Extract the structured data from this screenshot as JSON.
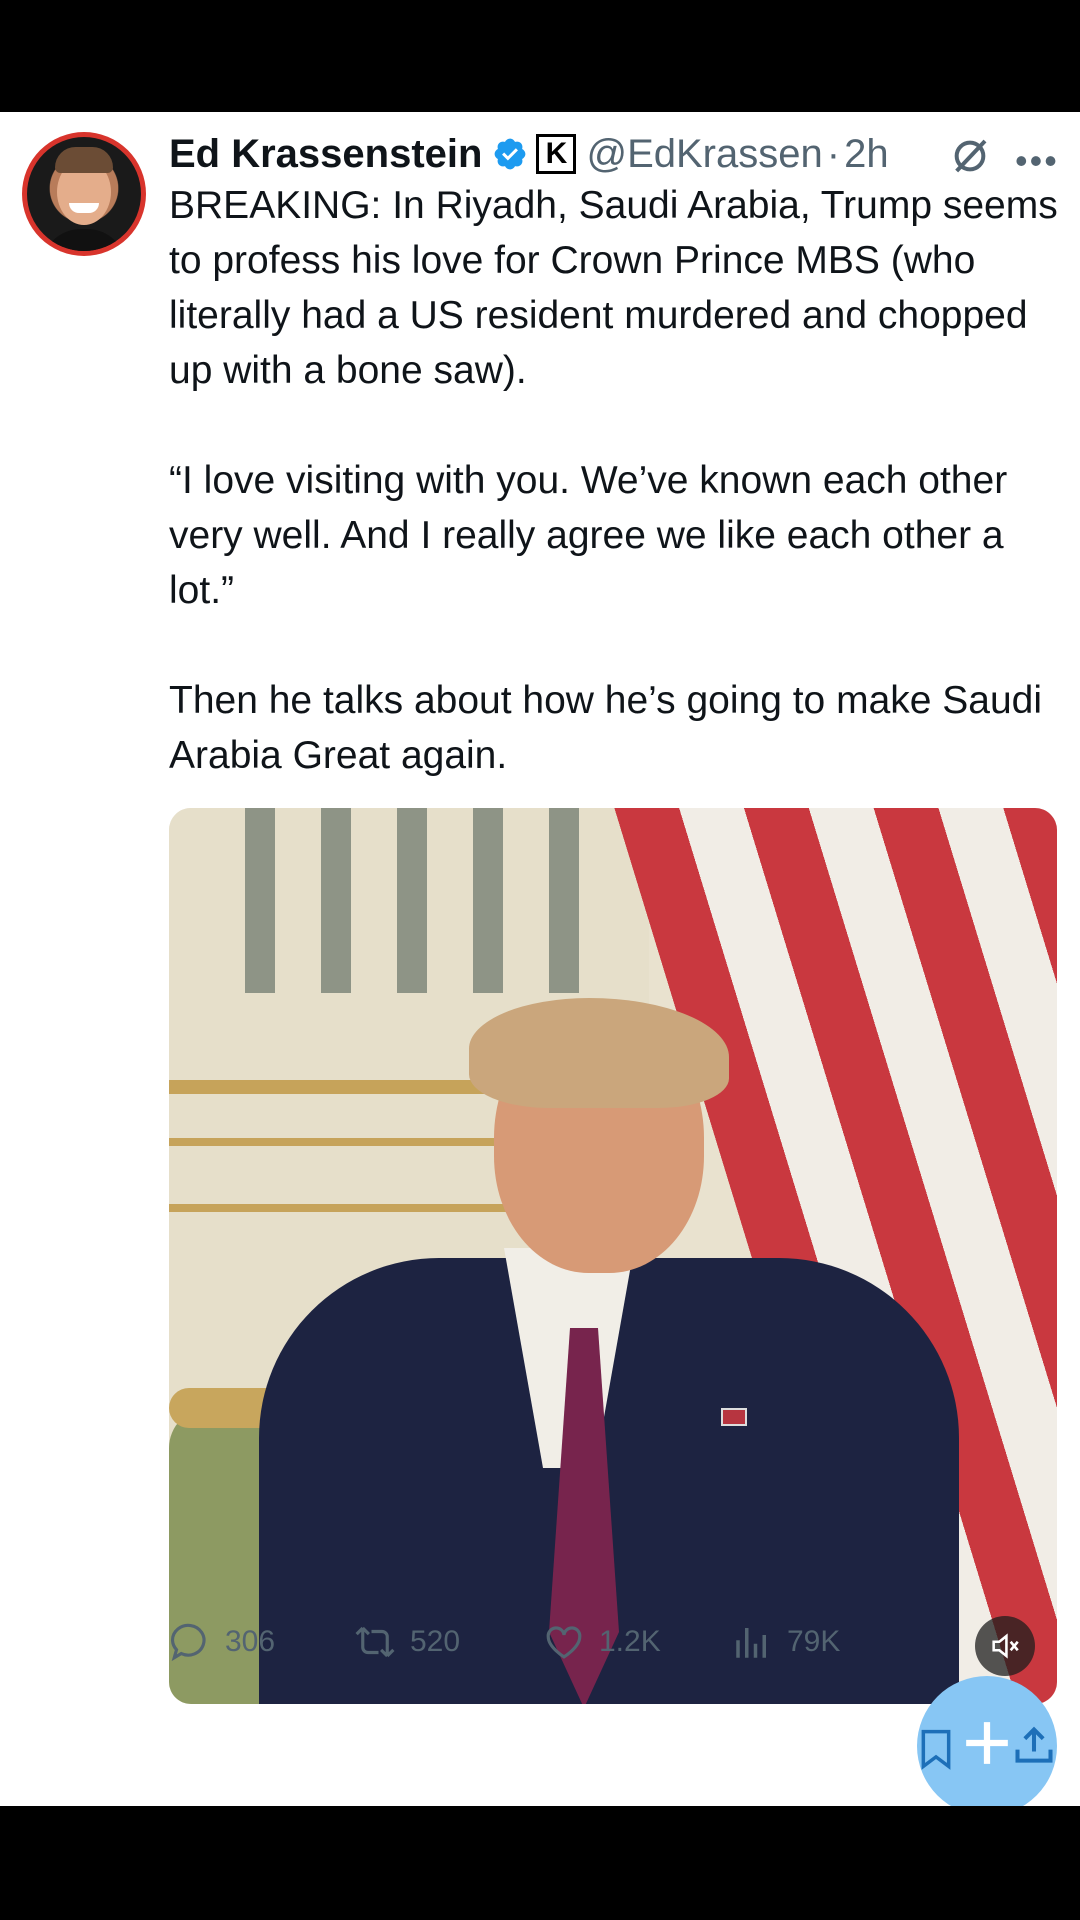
{
  "author": {
    "name": "Ed Krassenstein",
    "affiliate_badge": "K",
    "handle": "@EdKrassen",
    "separator": "·",
    "time": "2h"
  },
  "tweet": {
    "paragraph1": "BREAKING: In Riyadh, Saudi Arabia, Trump seems to profess his love for Crown Prince MBS (who literally had a US resident murdered and chopped up with a bone saw).",
    "paragraph2": "“I love visiting with you. We’ve known each other very well. And I really agree we like each other a lot.”",
    "paragraph3": "Then he talks about how he’s going to make Saudi Arabia Great again."
  },
  "actions": {
    "replies": "306",
    "reposts": "520",
    "likes": "1.2K",
    "views": "79K"
  },
  "icons": {
    "verified": "verified-badge-icon",
    "grok": "grok-icon",
    "more": "more-icon",
    "mute": "mute-icon",
    "reply": "reply-icon",
    "repost": "repost-icon",
    "like": "like-icon",
    "views": "views-icon",
    "bookmark": "bookmark-icon",
    "share": "share-icon",
    "compose": "compose-plus-icon"
  },
  "colors": {
    "accent": "#1d9bf0",
    "muted": "#536471",
    "text": "#0f1419",
    "fab": "#87c6f4"
  }
}
